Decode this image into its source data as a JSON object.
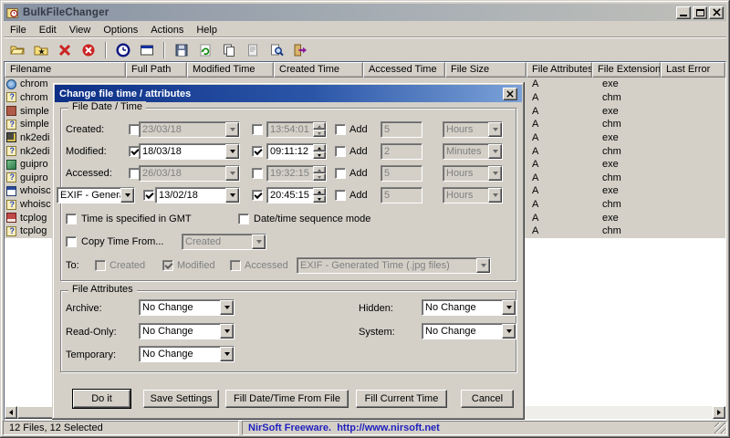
{
  "window": {
    "title": "BulkFileChanger"
  },
  "menu": {
    "items": [
      "File",
      "Edit",
      "View",
      "Options",
      "Actions",
      "Help"
    ]
  },
  "toolbar": {
    "icons": [
      "open-files",
      "add-files-from-folder",
      "remove-selected",
      "clear-list",
      "change-time-attributes",
      "open-with-window",
      "save-settings",
      "refresh",
      "copy-selected-files",
      "file-properties",
      "find",
      "exit"
    ]
  },
  "list": {
    "columns": [
      "Filename",
      "Full Path",
      "Modified Time",
      "Created Time",
      "Accessed Time",
      "File Size",
      "File Attributes",
      "File Extension",
      "Last Error"
    ],
    "rows": [
      {
        "name": "chrom",
        "attr": "A",
        "ext": "exe",
        "icon": "app-icon"
      },
      {
        "name": "chrom",
        "attr": "A",
        "ext": "chm",
        "icon": "help-file-icon"
      },
      {
        "name": "simple",
        "attr": "A",
        "ext": "exe",
        "icon": "app-icon"
      },
      {
        "name": "simple",
        "attr": "A",
        "ext": "chm",
        "icon": "help-file-icon"
      },
      {
        "name": "nk2edi",
        "attr": "A",
        "ext": "exe",
        "icon": "app-icon"
      },
      {
        "name": "nk2edi",
        "attr": "A",
        "ext": "chm",
        "icon": "help-file-icon"
      },
      {
        "name": "guipro",
        "attr": "A",
        "ext": "exe",
        "icon": "app-icon"
      },
      {
        "name": "guipro",
        "attr": "A",
        "ext": "chm",
        "icon": "help-file-icon"
      },
      {
        "name": "whoisc",
        "attr": "A",
        "ext": "exe",
        "icon": "app-icon"
      },
      {
        "name": "whoisc",
        "attr": "A",
        "ext": "chm",
        "icon": "help-file-icon"
      },
      {
        "name": "tcplog",
        "attr": "A",
        "ext": "exe",
        "icon": "app-icon"
      },
      {
        "name": "tcplog",
        "attr": "A",
        "ext": "chm",
        "icon": "help-file-icon"
      }
    ]
  },
  "statusbar": {
    "left": "12 Files, 12 Selected",
    "right": "NirSoft Freeware.  http://www.nirsoft.net"
  },
  "dialog": {
    "title": "Change file time / attributes",
    "date_group": {
      "label": "File Date / Time",
      "rows": [
        {
          "label": "Created:",
          "date": "23/03/18",
          "time": "13:54:01",
          "add_label": "Add",
          "amount": "5",
          "unit": "Hours"
        },
        {
          "label": "Modified:",
          "date": "18/03/18",
          "time": "09:11:12",
          "add_label": "Add",
          "amount": "2",
          "unit": "Minutes"
        },
        {
          "label": "Accessed:",
          "date": "26/03/18",
          "time": "19:32:15",
          "add_label": "Add",
          "amount": "5",
          "unit": "Hours"
        },
        {
          "label": "EXIF - Generated",
          "date": "13/02/18",
          "time": "20:45:15",
          "add_label": "Add",
          "amount": "5",
          "unit": "Hours"
        }
      ],
      "gmt_label": "Time is specified in GMT",
      "sequence_label": "Date/time sequence mode",
      "copy_from_label": "Copy Time From...",
      "copy_from_value": "Created",
      "to_label": "To:",
      "to_created": "Created",
      "to_modified": "Modified",
      "to_accessed": "Accessed",
      "to_target": "EXIF - Generated Time (.jpg files)"
    },
    "attr_group": {
      "label": "File Attributes",
      "archive_label": "Archive:",
      "archive_value": "No Change",
      "hidden_label": "Hidden:",
      "hidden_value": "No Change",
      "readonly_label": "Read-Only:",
      "readonly_value": "No Change",
      "system_label": "System:",
      "system_value": "No Change",
      "temporary_label": "Temporary:",
      "temporary_value": "No Change"
    },
    "buttons": {
      "do_it": "Do it",
      "save_settings": "Save Settings",
      "fill_from_file": "Fill Date/Time From File",
      "fill_current": "Fill Current Time",
      "cancel": "Cancel"
    },
    "accent": "#0d2f86"
  }
}
